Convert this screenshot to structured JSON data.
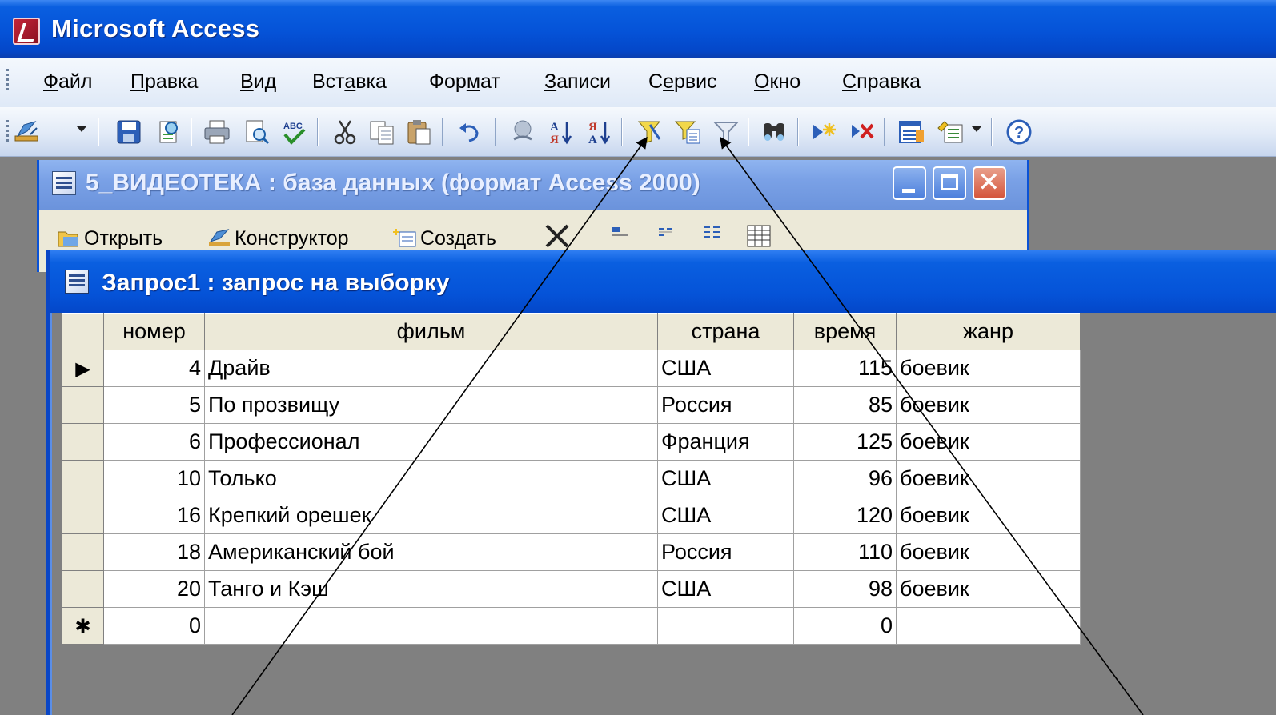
{
  "app": {
    "title": "Microsoft Access"
  },
  "menu": {
    "items": [
      {
        "pre": "",
        "u": "Ф",
        "post": "айл"
      },
      {
        "pre": "",
        "u": "П",
        "post": "равка"
      },
      {
        "pre": "",
        "u": "В",
        "post": "ид"
      },
      {
        "pre": "Вст",
        "u": "а",
        "post": "вка"
      },
      {
        "pre": "Фор",
        "u": "м",
        "post": "ат"
      },
      {
        "pre": "",
        "u": "З",
        "post": "аписи"
      },
      {
        "pre": "С",
        "u": "е",
        "post": "рвис"
      },
      {
        "pre": "",
        "u": "О",
        "post": "кно"
      },
      {
        "pre": "",
        "u": "С",
        "post": "правка"
      }
    ]
  },
  "toolbar": {
    "icons": [
      "design-view-icon",
      "save-icon",
      "file-search-icon",
      "print-icon",
      "print-preview-icon",
      "spelling-icon",
      "cut-icon",
      "copy-icon",
      "paste-icon",
      "undo-icon",
      "hyperlink-icon",
      "sort-ascending-icon",
      "sort-descending-icon",
      "filter-by-selection-icon",
      "filter-by-form-icon",
      "apply-filter-icon",
      "find-icon",
      "new-record-icon",
      "delete-record-icon",
      "database-window-icon",
      "new-object-icon",
      "help-icon"
    ],
    "sort_asc_glyph": "А↓",
    "sort_desc_glyph": "Я↓",
    "sort_asc_small": "Я",
    "sort_desc_small": "А"
  },
  "db_window": {
    "title": "5_ВИДЕОТЕКА : база данных (формат Access 2000)",
    "toolbar": {
      "open": "Открыть",
      "design": "Конструктор",
      "create": "Создать"
    }
  },
  "query_window": {
    "title": "Запрос1 : запрос на выборку"
  },
  "datasheet": {
    "columns": [
      "номер",
      "фильм",
      "страна",
      "время",
      "жанр"
    ],
    "rows": [
      {
        "id": "4",
        "film": "Драйв",
        "country": "США",
        "time": "115",
        "genre": "боевик"
      },
      {
        "id": "5",
        "film": "По прозвищу",
        "country": "Россия",
        "time": "85",
        "genre": "боевик"
      },
      {
        "id": "6",
        "film": "Профессионал",
        "country": "Франция",
        "time": "125",
        "genre": "боевик"
      },
      {
        "id": "10",
        "film": "Только",
        "country": "США",
        "time": "96",
        "genre": "боевик"
      },
      {
        "id": "16",
        "film": "Крепкий орешек",
        "country": "США",
        "time": "120",
        "genre": "боевик"
      },
      {
        "id": "18",
        "film": "Американский бой",
        "country": "Россия",
        "time": "110",
        "genre": "боевик"
      },
      {
        "id": "20",
        "film": "Танго и Кэш",
        "country": "США",
        "time": "98",
        "genre": "боевик"
      }
    ],
    "new_row": {
      "id": "0",
      "time": "0"
    },
    "current_row_marker": "▶",
    "new_row_marker": "✱"
  },
  "colors": {
    "title_blue": "#0553d8",
    "menu_bg": "#dfe9f7",
    "workspace": "#808080",
    "grid_header": "#ece9d8"
  }
}
